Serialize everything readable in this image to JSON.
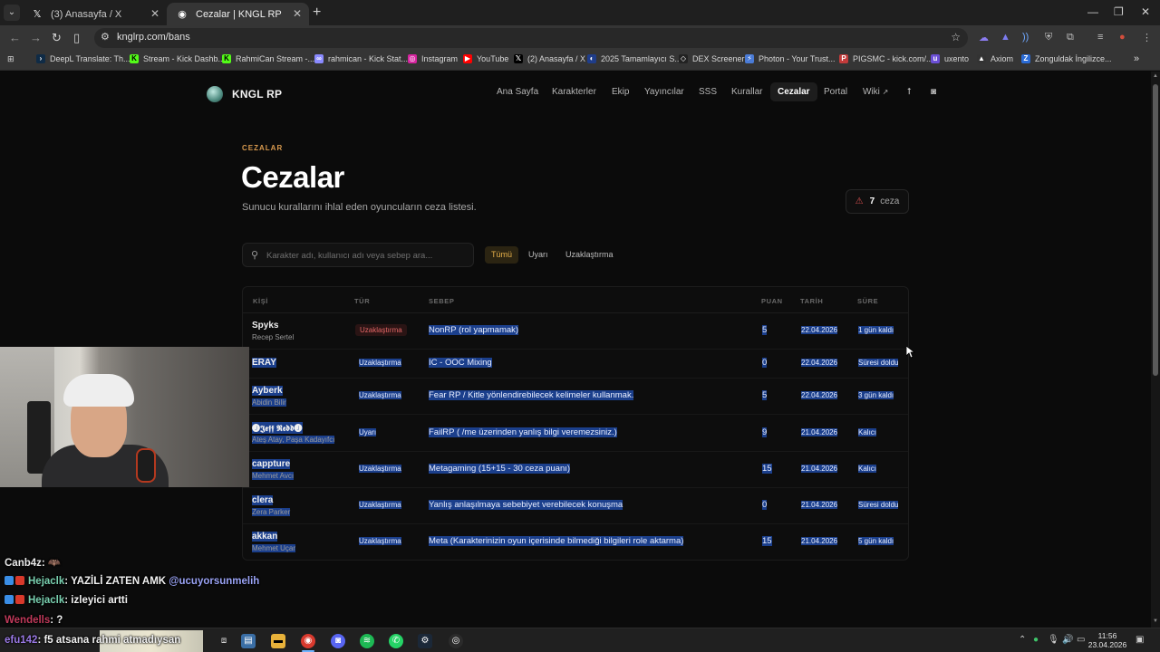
{
  "browser": {
    "tabs": [
      {
        "title": "(3) Anasayfa / X",
        "icon": "x-logo-icon",
        "active": false
      },
      {
        "title": "Cezalar | KNGL RP",
        "icon": "kngl-favicon-icon",
        "active": true
      }
    ],
    "url": "knglrp.com/bans",
    "bookmarks": [
      {
        "label": "DeepL Translate: Th...",
        "color": "#0f2b46"
      },
      {
        "label": "Stream - Kick Dashb...",
        "color": "#53fc18"
      },
      {
        "label": "RahmiCan Stream -...",
        "color": "#53fc18"
      },
      {
        "label": "rahmican - Kick Stat...",
        "color": "#8a8aff"
      },
      {
        "label": "Instagram",
        "color": "#d6249f"
      },
      {
        "label": "YouTube",
        "color": "#ff0000"
      },
      {
        "label": "(2) Anasayfa / X",
        "color": "#000000"
      },
      {
        "label": "2025 Tamamlayıcı S...",
        "color": "#1f3d8a"
      },
      {
        "label": "DEX Screener",
        "color": "#222222"
      },
      {
        "label": "Photon - Your Trust...",
        "color": "#4a7bd6"
      },
      {
        "label": "PIGSMC - kick.com/...",
        "color": "#c23b3b"
      },
      {
        "label": "uxento",
        "color": "#6b4fd6"
      },
      {
        "label": "Axiom",
        "color": "#333333"
      },
      {
        "label": "Zonguldak İngilizce...",
        "color": "#2a6bd6"
      }
    ]
  },
  "site": {
    "brand": "KNGL RP",
    "nav": [
      "Ana Sayfa",
      "Karakterler",
      "Ekip",
      "Yayıncılar",
      "SSS",
      "Kurallar",
      "Cezalar",
      "Portal",
      "Wiki"
    ],
    "active_nav": "Cezalar"
  },
  "hero": {
    "eyebrow": "CEZALAR",
    "title": "Cezalar",
    "subtitle": "Sunucu kurallarını ihlal eden oyuncuların ceza listesi.",
    "count": "7",
    "count_label": "ceza"
  },
  "search": {
    "placeholder": "Karakter adı, kullanıcı adı veya sebep ara...",
    "filters": [
      "Tümü",
      "Uyarı",
      "Uzaklaştırma"
    ],
    "active_filter": "Tümü"
  },
  "table": {
    "headers": [
      "KİŞİ",
      "TÜR",
      "SEBEP",
      "PUAN",
      "TARİH",
      "SÜRE"
    ],
    "rows": [
      {
        "player": "Spyks",
        "character": "Recep Sertel",
        "type": "Uzaklaştırma",
        "reason": "NonRP (rol yapmamak)",
        "points": "5",
        "date": "22.04.2026",
        "duration": "1 gün kaldı",
        "selected_player": false
      },
      {
        "player": "ERAY",
        "character": "",
        "type": "Uzaklaştırma",
        "reason": "IC - OOC Mixing",
        "points": "0",
        "date": "22.04.2026",
        "duration": "Süresi doldu",
        "selected_player": true
      },
      {
        "player": "Ayberk",
        "character": "Abidin Bilir",
        "type": "Uzaklaştırma",
        "reason": "Fear RP / Kitle yönlendirebilecek kelimeler kullanmak.",
        "points": "5",
        "date": "22.04.2026",
        "duration": "3 gün kaldı",
        "selected_player": true
      },
      {
        "player": "🅙𝕵𝖊𝖋𝖋 𝕽𝖊𝖉𝖉🅙",
        "character": "Ateş Atay, Paşa Kadayıfcı",
        "type": "Uyarı",
        "reason": "FailRP ( /me üzerinden yanlış bilgi veremezsiniz.)",
        "points": "9",
        "date": "21.04.2026",
        "duration": "Kalıcı",
        "selected_player": true
      },
      {
        "player": "cappture",
        "character": "Mehmet Avcı",
        "type": "Uzaklaştırma",
        "reason": "Metagaming (15+15 - 30 ceza puanı)",
        "points": "15",
        "date": "21.04.2026",
        "duration": "Kalıcı",
        "selected_player": true
      },
      {
        "player": "clera",
        "character": "Zera Parker",
        "type": "Uzaklaştırma",
        "reason": "Yanlış anlaşılmaya sebebiyet verebilecek konuşma",
        "points": "0",
        "date": "21.04.2026",
        "duration": "Süresi doldu",
        "selected_player": true
      },
      {
        "player": "akkan",
        "character": "Mehmet Uçar",
        "type": "Uzaklaştırma",
        "reason": "Meta (Karakterinizin oyun içerisinde bilmediği bilgileri role aktarma)",
        "points": "15",
        "date": "21.04.2026",
        "duration": "5 gün kaldı",
        "selected_player": true
      }
    ]
  },
  "stream_chat": [
    {
      "user": "Canb4z",
      "text": ": 🦇"
    },
    {
      "user": "Hejaclk",
      "text": ": YAZİLİ ZATEN AMK ",
      "mention": "@ucuyorsunmelih"
    },
    {
      "user": "Hejaclk",
      "text": ": izleyici artti"
    },
    {
      "user": "Wendells",
      "text": ": ?"
    },
    {
      "user": "efu142",
      "text": ": f5 atsana rahmi atmadıysan"
    }
  ],
  "taskbar": {
    "time": "11:56",
    "date": "23.04.2026"
  },
  "colors": {
    "accent": "#d99a4e",
    "danger": "#e05252",
    "selection": "#1b3f8c"
  }
}
